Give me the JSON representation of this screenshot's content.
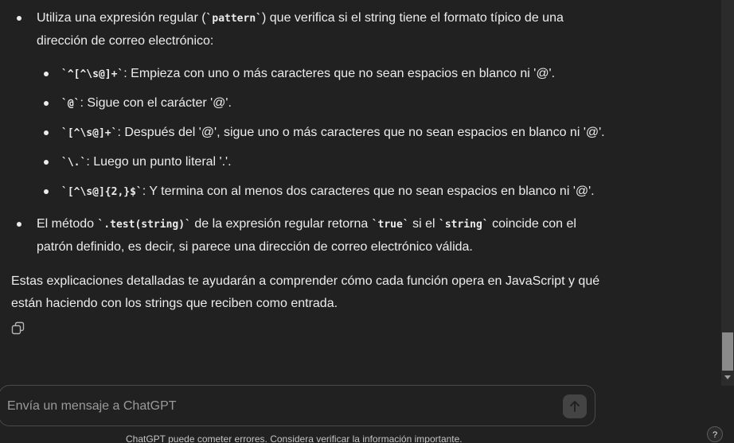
{
  "message": {
    "bullet1": {
      "text_before": "Utiliza una expresión regular (",
      "code": "`pattern`",
      "text_after_line1": ") que verifica si el string tiene el formato típico de una",
      "line2": "dirección de correo electrónico:"
    },
    "sub_items": [
      {
        "code": "`^[^\\s@]+`",
        "text": ": Empieza con uno o más caracteres que no sean espacios en blanco ni '@'."
      },
      {
        "code": "`@`",
        "text": ": Sigue con el carácter '@'."
      },
      {
        "code": "`[^\\s@]+`",
        "text": ": Después del '@', sigue uno o más caracteres que no sean espacios en blanco ni '@'."
      },
      {
        "code": "`\\.`",
        "text": ": Luego un punto literal '.'."
      },
      {
        "code": "`[^\\s@]{2,}$`",
        "text": ": Y termina con al menos dos caracteres que no sean espacios en blanco ni '@'."
      }
    ],
    "bullet2": {
      "text1": "El método ",
      "code1": "`.test(string)`",
      "text2": " de la expresión regular retorna ",
      "code2": "`true`",
      "text3": " si el ",
      "code3": "`string`",
      "text4": " coincide con el",
      "line2": "patrón definido, es decir, si parece una dirección de correo electrónico válida."
    },
    "summary_line1": "Estas explicaciones detalladas te ayudarán a comprender cómo cada función opera en JavaScript y qué",
    "summary_line2": "están haciendo con los strings que reciben como entrada."
  },
  "composer": {
    "placeholder": "Envía un mensaje a ChatGPT"
  },
  "disclaimer": "ChatGPT puede cometer errores. Considera verificar la información importante.",
  "help_label": "?",
  "icons": {
    "copy": "copy-icon",
    "send": "arrow-up-icon"
  }
}
